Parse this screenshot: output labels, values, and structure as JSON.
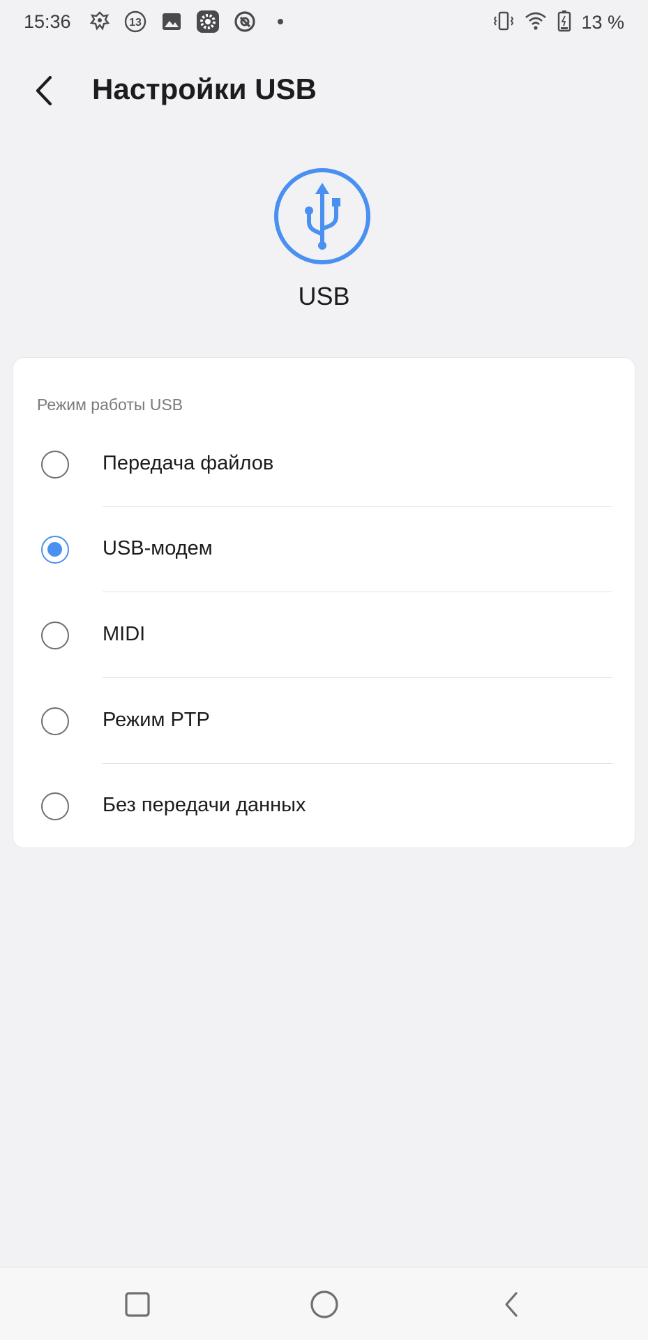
{
  "status_bar": {
    "time": "15:36",
    "notification_icons": [
      "app-icon",
      "badge-13-icon",
      "gallery-icon",
      "settings-icon",
      "sync-icon",
      "dot-icon"
    ],
    "badge_number": "13",
    "battery_text": "13 %",
    "right_icons": [
      "vibrate-icon",
      "wifi-icon",
      "battery-icon"
    ]
  },
  "header": {
    "back_icon": "back-arrow-icon",
    "title": "Настройки USB"
  },
  "usb_badge": {
    "icon": "usb-icon",
    "label": "USB",
    "accent_color": "#4a90f0"
  },
  "usb_mode": {
    "section_title": "Режим работы USB",
    "options": [
      {
        "label": "Передача файлов",
        "selected": false
      },
      {
        "label": "USB-модем",
        "selected": true
      },
      {
        "label": "MIDI",
        "selected": false
      },
      {
        "label": "Режим PTP",
        "selected": false
      },
      {
        "label": "Без передачи данных",
        "selected": false
      }
    ]
  },
  "nav_bar": {
    "buttons": [
      "recents-square-icon",
      "home-circle-icon",
      "back-triangle-icon"
    ]
  }
}
